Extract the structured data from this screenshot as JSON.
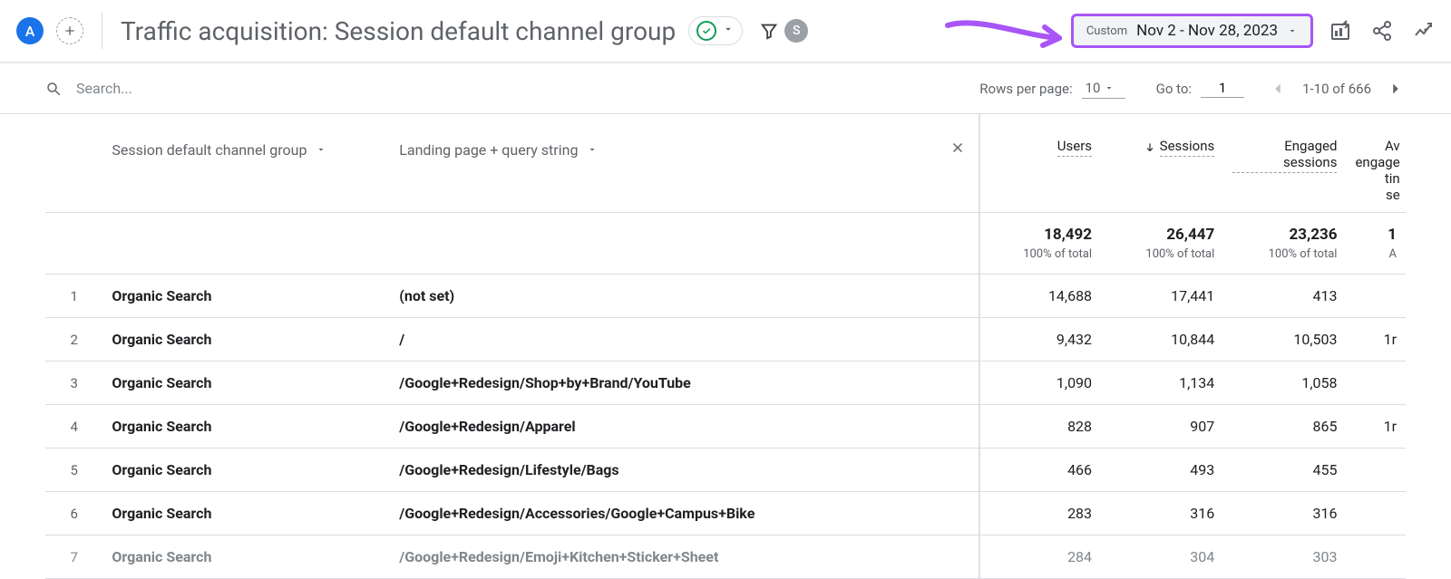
{
  "header": {
    "avatar_letter": "A",
    "title": "Traffic acquisition: Session default channel group",
    "filter_pill": "S",
    "date_label": "Custom",
    "date_range": "Nov 2 - Nov 28, 2023"
  },
  "toolbar": {
    "search_placeholder": "Search...",
    "rows_per_page_label": "Rows per page:",
    "rows_per_page_value": "10",
    "goto_label": "Go to:",
    "goto_value": "1",
    "range_text": "1-10 of 666"
  },
  "columns": {
    "primary_dimension": "Session default channel group",
    "secondary_dimension": "Landing page + query string",
    "metrics": [
      "Users",
      "Sessions",
      "Engaged sessions",
      "Average engagement time per session"
    ],
    "metric_trunc": [
      "Av",
      "engage",
      "tin",
      "se"
    ]
  },
  "totals": {
    "users": {
      "value": "18,492",
      "sub": "100% of total"
    },
    "sessions": {
      "value": "26,447",
      "sub": "100% of total"
    },
    "engaged": {
      "value": "23,236",
      "sub": "100% of total"
    },
    "avg_trunc": {
      "value": "1",
      "sub": "A"
    }
  },
  "rows": [
    {
      "idx": "1",
      "dim1": "Organic Search",
      "dim2": "(not set)",
      "users": "14,688",
      "sessions": "17,441",
      "engaged": "413",
      "avg": ""
    },
    {
      "idx": "2",
      "dim1": "Organic Search",
      "dim2": "/",
      "users": "9,432",
      "sessions": "10,844",
      "engaged": "10,503",
      "avg": "1r"
    },
    {
      "idx": "3",
      "dim1": "Organic Search",
      "dim2": "/Google+Redesign/Shop+by+Brand/YouTube",
      "users": "1,090",
      "sessions": "1,134",
      "engaged": "1,058",
      "avg": ""
    },
    {
      "idx": "4",
      "dim1": "Organic Search",
      "dim2": "/Google+Redesign/Apparel",
      "users": "828",
      "sessions": "907",
      "engaged": "865",
      "avg": "1r"
    },
    {
      "idx": "5",
      "dim1": "Organic Search",
      "dim2": "/Google+Redesign/Lifestyle/Bags",
      "users": "466",
      "sessions": "493",
      "engaged": "455",
      "avg": ""
    },
    {
      "idx": "6",
      "dim1": "Organic Search",
      "dim2": "/Google+Redesign/Accessories/Google+Campus+Bike",
      "users": "283",
      "sessions": "316",
      "engaged": "316",
      "avg": ""
    },
    {
      "idx": "7",
      "dim1": "Organic Search",
      "dim2": "/Google+Redesign/Emoji+Kitchen+Sticker+Sheet",
      "users": "284",
      "sessions": "304",
      "engaged": "303",
      "avg": ""
    }
  ]
}
